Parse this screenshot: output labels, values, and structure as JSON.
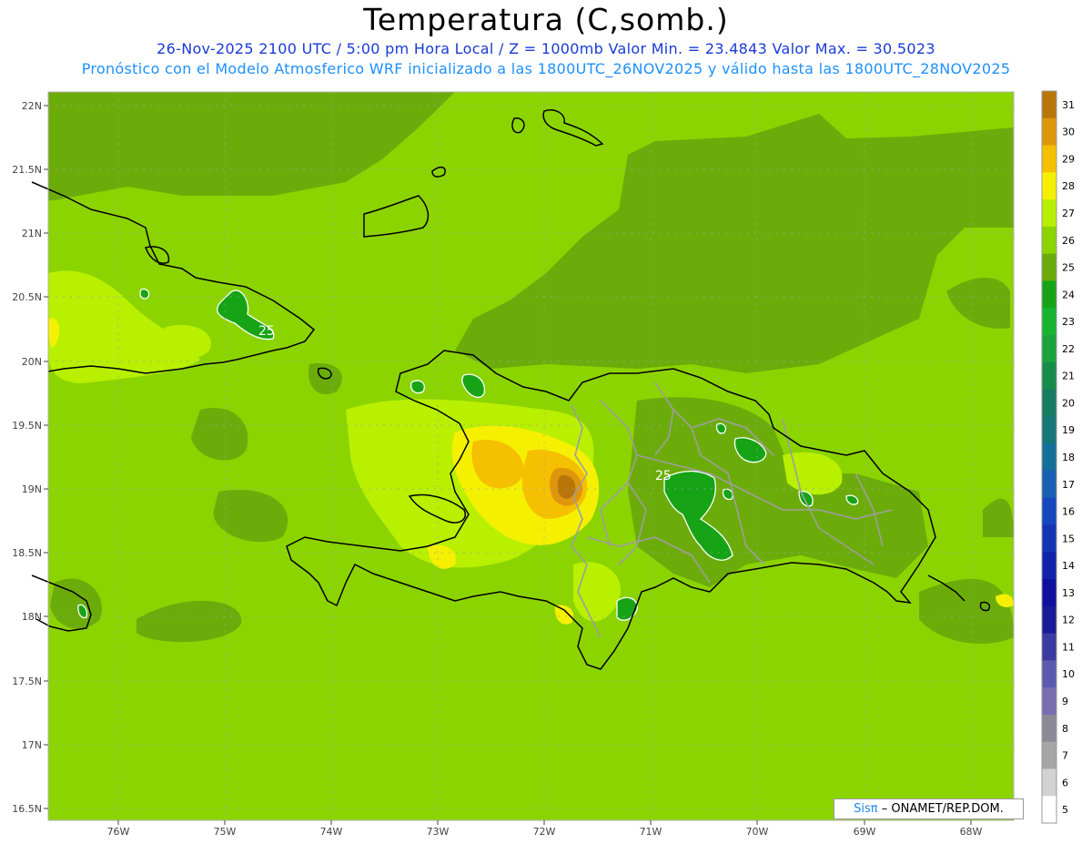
{
  "header": {
    "title": "Temperatura (C,somb.)",
    "subtitle_line1": "26-Nov-2025 2100 UTC / 5:00 pm Hora Local / Z = 1000mb   Valor Min. = 23.4843  Valor Max. = 30.5023",
    "subtitle_line2": "Pronóstico con el Modelo Atmosferico WRF inicializado a las 1800UTC_26NOV2025 y válido hasta las  1800UTC_28NOV2025"
  },
  "axes": {
    "lat_labels": [
      "22N",
      "21.5N",
      "21N",
      "20.5N",
      "20N",
      "19.5N",
      "19N",
      "18.5N",
      "18N",
      "17.5N",
      "17N",
      "16.5N"
    ],
    "lon_labels": [
      "76W",
      "75W",
      "74W",
      "73W",
      "72W",
      "71W",
      "70W",
      "69W",
      "68W"
    ]
  },
  "contour_labels": [
    "25",
    "25"
  ],
  "colorbar": {
    "labels": [
      "31",
      "30",
      "29",
      "28",
      "27",
      "26",
      "25",
      "24",
      "23",
      "22",
      "21",
      "20",
      "19",
      "18",
      "17",
      "16",
      "15",
      "14",
      "13",
      "12",
      "11",
      "10",
      "9",
      "8",
      "7",
      "6",
      "5"
    ],
    "colors": [
      "#b8760a",
      "#e0960c",
      "#f5c000",
      "#f5f000",
      "#b8f000",
      "#8cd400",
      "#6cac0a",
      "#16a416",
      "#18b430",
      "#1aa43e",
      "#188c4a",
      "#147c62",
      "#147878",
      "#14709a",
      "#1860b4",
      "#1446be",
      "#1434b4",
      "#1022aa",
      "#1010a0",
      "#1a1a96",
      "#3a3aa0",
      "#5a5ab0",
      "#7a6eb2",
      "#8a8a96",
      "#a6a6a6",
      "#d2d2d2",
      "#ffffff"
    ]
  },
  "credit": {
    "brand": "Sisπ",
    "text": "– ONAMET/REP.DOM."
  },
  "palette": {
    "sea_base": "#8cd400",
    "dark_green": "#6cac0a",
    "light_green": "#b8f000",
    "yellow": "#f5f000",
    "gold": "#f5c000",
    "orange": "#e0960c",
    "brown": "#b8760a",
    "green25": "#16a416"
  }
}
